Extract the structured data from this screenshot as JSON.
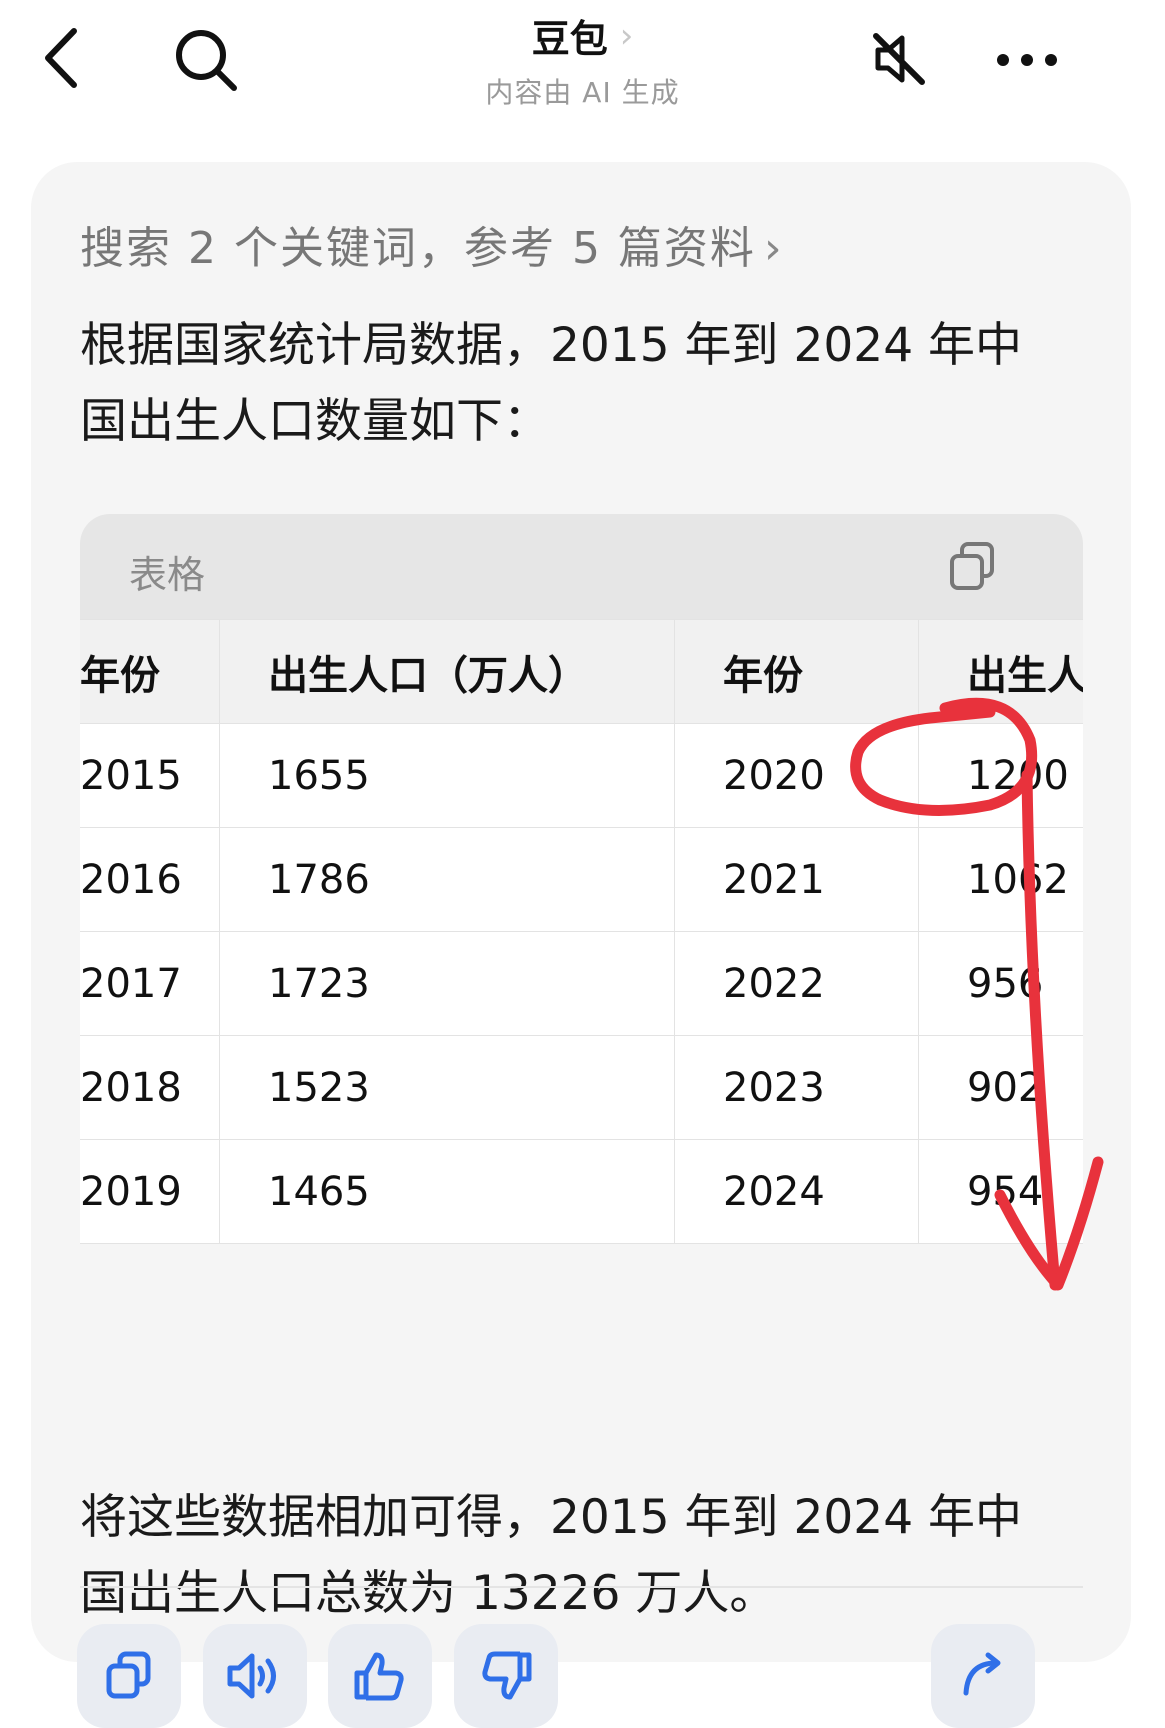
{
  "header": {
    "title": "豆包",
    "title_chevron": "›",
    "subtitle": "内容由 AI 生成",
    "icons": [
      "back-arrow-icon",
      "search-icon",
      "speaker-muted-icon",
      "more-icon"
    ]
  },
  "message": {
    "search_summary": "搜索 2 个关键词，参考 5 篇资料",
    "search_arrow": "›",
    "intro_line1": "根据国家统计局数据，2015 年到 2024 年中",
    "intro_line2": "国出生人口数量如下：",
    "table": {
      "label": "表格",
      "headers": [
        "年份",
        "出生人口（万人）",
        "年份",
        "出生人口"
      ],
      "rows": [
        [
          "2015",
          "1655",
          "2020",
          "1200"
        ],
        [
          "2016",
          "1786",
          "2021",
          "1062"
        ],
        [
          "2017",
          "1723",
          "2022",
          "956"
        ],
        [
          "2018",
          "1523",
          "2023",
          "902"
        ],
        [
          "2019",
          "1465",
          "2024",
          "954"
        ]
      ]
    },
    "conclusion_line1": "将这些数据相加可得，2015 年到 2024 年中",
    "conclusion_line2": "国出生人口总数为 13226 万人。"
  },
  "actions": [
    "copy-icon",
    "read-aloud-icon",
    "thumbs-up-icon",
    "thumbs-down-icon",
    "share-icon"
  ],
  "colors": {
    "card_bg": "#f5f5f5",
    "table_header_bg": "#e6e6e6",
    "action_bg": "#e9ecf2",
    "action_icon": "#2f6fe8",
    "annotation_red": "#e8323c"
  }
}
